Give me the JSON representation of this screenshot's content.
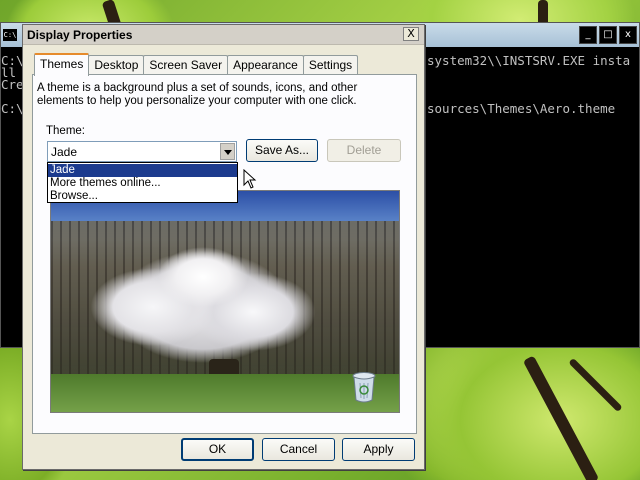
{
  "console": {
    "sys_icon": "C:\\",
    "lines": [
      "C:\\",
      "ll",
      "Cre",
      "",
      "C:\\"
    ],
    "right_line_1": "system32\\\\INSTSRV.EXE insta",
    "right_line_2": "sources\\Themes\\Aero.theme",
    "buttons": {
      "minimize": "_",
      "maximize": "□",
      "close": "x"
    }
  },
  "dialog": {
    "title": "Display Properties",
    "close_glyph": "X",
    "tabs": [
      "Themes",
      "Desktop",
      "Screen Saver",
      "Appearance",
      "Settings"
    ],
    "active_tab": "Themes",
    "description": "A theme is a background plus a set of sounds, icons, and other elements to help you personalize your computer with one click.",
    "theme_label": "Theme:",
    "theme_value": "Jade",
    "dropdown_options": [
      "Jade",
      "More themes online...",
      "Browse..."
    ],
    "selected_option": "Jade",
    "save_as_label": "Save As...",
    "delete_label": "Delete",
    "ok_label": "OK",
    "cancel_label": "Cancel",
    "apply_label": "Apply"
  },
  "colors": {
    "accent_tab": "#e68b2c",
    "selection": "#1c3b8e",
    "dialog_bg": "#ece9d8"
  },
  "icons": {
    "recycle_bin": "recycle-bin-icon",
    "cursor": "mouse-pointer-icon"
  }
}
